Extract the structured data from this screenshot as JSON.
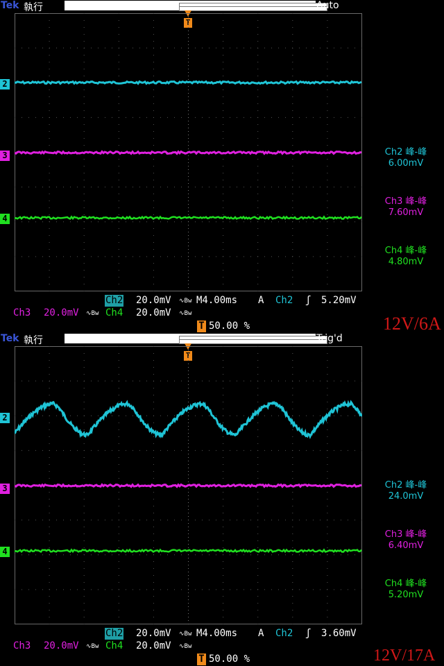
{
  "colors": {
    "ch2": "#1fc4d6",
    "ch3": "#e020e0",
    "ch4": "#20e020",
    "trigger": "#f08a1a",
    "grid": "#5a5a5a",
    "brand": "#3a56d8",
    "note": "#d01818"
  },
  "panels": [
    {
      "brand": "Tek",
      "run_label": "執行",
      "status": "Auto",
      "trigger_marker": "T",
      "channel_markers": [
        "2",
        "3",
        "4"
      ],
      "measurements": [
        {
          "label": "Ch2 峰-峰",
          "value": "6.00mV"
        },
        {
          "label": "Ch3 峰-峰",
          "value": "7.60mV"
        },
        {
          "label": "Ch4 峰-峰",
          "value": "4.80mV"
        }
      ],
      "footer": {
        "ch2_tag": "Ch2",
        "ch2_scale": "20.0mV",
        "bw_icon": "∿Bw",
        "timebase": "M4.00ms",
        "trig_mode": "A",
        "trig_src": "Ch2",
        "trig_slope": "ʃ",
        "trig_level": "5.20mV",
        "ch3_tag": "Ch3",
        "ch3_scale": "20.0mV",
        "ch4_tag": "Ch4",
        "ch4_scale": "20.0mV",
        "trig_pos": "50.00 %"
      },
      "note": "12V/6A",
      "waveform": "flat"
    },
    {
      "brand": "Tek",
      "run_label": "執行",
      "status": "Trig'd",
      "trigger_marker": "T",
      "channel_markers": [
        "2",
        "3",
        "4"
      ],
      "measurements": [
        {
          "label": "Ch2 峰-峰",
          "value": "24.0mV"
        },
        {
          "label": "Ch3 峰-峰",
          "value": "6.40mV"
        },
        {
          "label": "Ch4 峰-峰",
          "value": "5.20mV"
        }
      ],
      "footer": {
        "ch2_tag": "Ch2",
        "ch2_scale": "20.0mV",
        "bw_icon": "∿Bw",
        "timebase": "M4.00ms",
        "trig_mode": "A",
        "trig_src": "Ch2",
        "trig_slope": "ʃ",
        "trig_level": "3.60mV",
        "ch3_tag": "Ch3",
        "ch3_scale": "20.0mV",
        "ch4_tag": "Ch4",
        "ch4_scale": "20.0mV",
        "trig_pos": "50.00 %"
      },
      "note": "12V/17A",
      "waveform": "ripple"
    }
  ]
}
